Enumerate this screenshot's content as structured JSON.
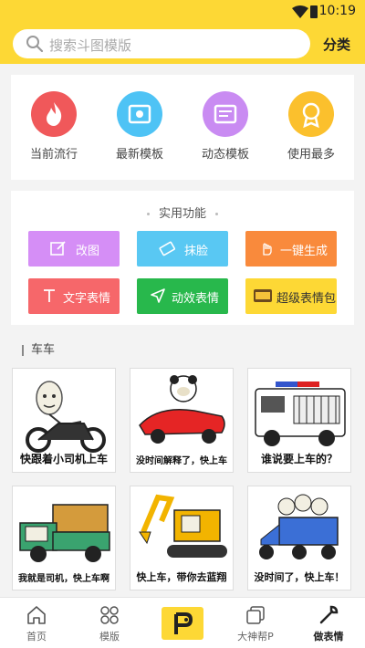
{
  "status": {
    "time": "10:19"
  },
  "header": {
    "search_placeholder": "搜索斗图模版",
    "category_label": "分类"
  },
  "categories": [
    {
      "label": "当前流行",
      "icon": "flame-icon",
      "color": "#f0585a"
    },
    {
      "label": "最新模板",
      "icon": "photo-icon",
      "color": "#4ec3f5"
    },
    {
      "label": "动态模板",
      "icon": "gif-card-icon",
      "color": "#c98bf2"
    },
    {
      "label": "使用最多",
      "icon": "award-icon",
      "color": "#fbc02d"
    }
  ],
  "tools": {
    "title": "实用功能",
    "buttons": [
      {
        "label": "改图",
        "icon": "edit-icon",
        "color": "#d58ef6"
      },
      {
        "label": "抹脸",
        "icon": "eraser-icon",
        "color": "#59c8f3"
      },
      {
        "label": "一键生成",
        "icon": "tap-icon",
        "color": "#f98a3c"
      },
      {
        "label": "文字表情",
        "icon": "text-icon",
        "color": "#f6676a"
      },
      {
        "label": "动效表情",
        "icon": "send-icon",
        "color": "#28b84c"
      },
      {
        "label": "超级表情包",
        "icon": "sticker-pack-icon",
        "color": "#fdd835"
      }
    ]
  },
  "section": {
    "title": "车车"
  },
  "memes": [
    {
      "caption": "快跟着小司机上车"
    },
    {
      "caption": "没时间解释了，快上车"
    },
    {
      "caption": "谁说要上车的？"
    },
    {
      "caption": "我就是司机，快上车啊"
    },
    {
      "caption": "快上车，带你去蓝翔"
    },
    {
      "caption": "没时间了，快上车！"
    }
  ],
  "tabbar": {
    "items": [
      {
        "label": "首页",
        "icon": "home-icon"
      },
      {
        "label": "模版",
        "icon": "grid-icon"
      },
      {
        "label": "",
        "icon": "p-logo-icon"
      },
      {
        "label": "大神帮P",
        "icon": "layers-icon"
      },
      {
        "label": "做表情",
        "icon": "wrench-icon"
      }
    ],
    "active_index": 4
  }
}
